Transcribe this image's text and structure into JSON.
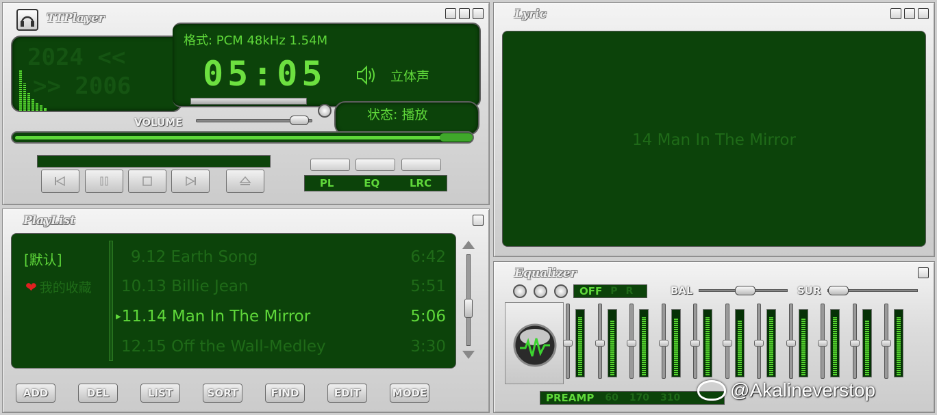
{
  "player": {
    "title": "TTPlayer",
    "format": "格式: PCM 48kHz 1.54M",
    "time": "05:05",
    "channel": "立体声",
    "status": "状态: 播放",
    "volume_label": "VOLUME",
    "scroll_text_1": "2024 <<",
    "scroll_text_2": ">> 2006",
    "mode_buttons": [
      "PL",
      "EQ",
      "LRC"
    ],
    "transport_icons": [
      "prev-icon",
      "pause-icon",
      "stop-icon",
      "next-icon",
      "eject-icon"
    ],
    "volume_level": 0.75,
    "progress": 0.95
  },
  "lyric": {
    "title": "Lyric",
    "current_line": "14 Man In The Mirror"
  },
  "playlist": {
    "title": "PlayList",
    "lists": [
      "[默认]",
      "我的收藏"
    ],
    "tracks": [
      {
        "name": "9.12 Earth Song",
        "duration": "6:42"
      },
      {
        "name": "10.13 Billie Jean",
        "duration": "5:51"
      },
      {
        "name": "11.14 Man In The Mirror",
        "duration": "5:06"
      },
      {
        "name": "12.15 Off the Wall-Medley",
        "duration": "3:30"
      }
    ],
    "buttons": [
      "ADD",
      "DEL",
      "LIST",
      "SORT",
      "FIND",
      "EDIT",
      "MODE"
    ]
  },
  "equalizer": {
    "title": "Equalizer",
    "off_label": "OFF",
    "p_label": "P",
    "r_label": "R",
    "bal_label": "BAL",
    "sur_label": "SUR",
    "preamp_label": "PREAMP",
    "band_labels": [
      "60",
      "170",
      "310"
    ],
    "band_levels": [
      0.9,
      0.85,
      0.9,
      0.88,
      0.9,
      0.85,
      0.9,
      0.88,
      0.9,
      0.86,
      0.9
    ]
  },
  "watermark": "@Akalineverstop",
  "colors": {
    "lcd_background": "#0c430a",
    "lcd_text": "#5fd83a",
    "lcd_dim_text": "#1f5f18",
    "heart": "#e02020"
  }
}
